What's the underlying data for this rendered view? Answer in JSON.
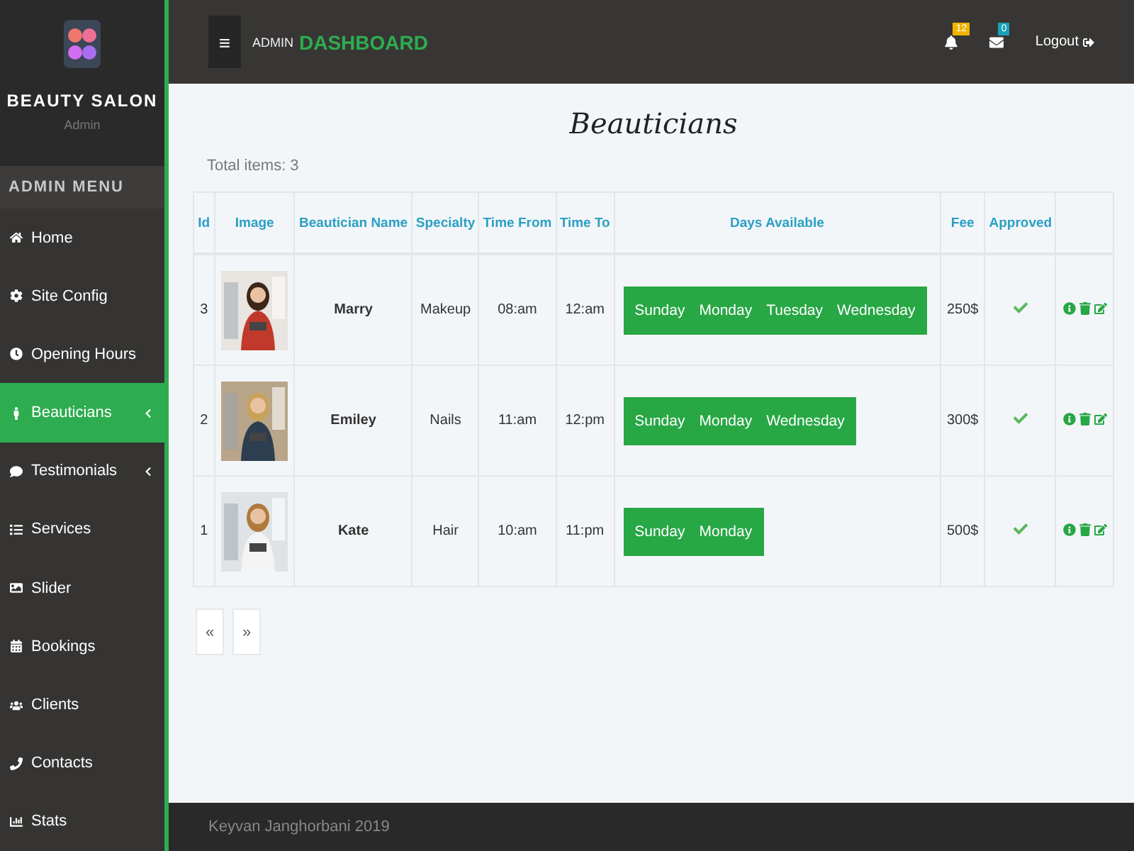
{
  "brand": {
    "title": "BEAUTY SALON",
    "subtitle": "Admin"
  },
  "menu_heading": "ADMIN MENU",
  "menu": [
    {
      "label": "Home",
      "selected": false,
      "submenu": false
    },
    {
      "label": "Site Config",
      "selected": false,
      "submenu": false
    },
    {
      "label": "Opening Hours",
      "selected": false,
      "submenu": false
    },
    {
      "label": "Beauticians",
      "selected": true,
      "submenu": true
    },
    {
      "label": "Testimonials",
      "selected": false,
      "submenu": true
    },
    {
      "label": "Services",
      "selected": false,
      "submenu": false
    },
    {
      "label": "Slider",
      "selected": false,
      "submenu": false
    },
    {
      "label": "Bookings",
      "selected": false,
      "submenu": false
    },
    {
      "label": "Clients",
      "selected": false,
      "submenu": false
    },
    {
      "label": "Contacts",
      "selected": false,
      "submenu": false
    },
    {
      "label": "Stats",
      "selected": false,
      "submenu": false
    }
  ],
  "topbar": {
    "menu_toggle": "≡",
    "title_prefix": "ADMIN",
    "title_main": "DASHBOARD",
    "notifications": "12",
    "messages": "0",
    "logout": "Logout"
  },
  "page_title": "Beauticians",
  "total": "Total items: 3",
  "table": {
    "columns": [
      "Id",
      "Image",
      "Beautician Name",
      "Specialty",
      "Time From",
      "Time To",
      "Days Available",
      "Fee",
      "Approved"
    ],
    "rows": [
      {
        "id": "3",
        "image": {
          "kind": "picture"
        },
        "name": "Marry",
        "specialty": "Makeup",
        "time_from": "08:am",
        "time_to": "12:am",
        "days": [
          "Sunday",
          "Monday",
          "Tuesday",
          "Wednesday"
        ],
        "fee": "250$",
        "approved": true
      },
      {
        "id": "2",
        "image": {
          "kind": "picture"
        },
        "name": "Emiley",
        "specialty": "Nails",
        "time_from": "11:am",
        "time_to": "12:pm",
        "days": [
          "Sunday",
          "Monday",
          "Wednesday"
        ],
        "fee": "300$",
        "approved": true
      },
      {
        "id": "1",
        "image": {
          "kind": "picture"
        },
        "name": "Kate",
        "specialty": "Hair",
        "time_from": "10:am",
        "time_to": "11:pm",
        "days": [
          "Sunday",
          "Monday"
        ],
        "fee": "500$",
        "approved": true
      }
    ]
  },
  "pagination": [
    "«",
    "»"
  ],
  "footer": "Keyvan Janghorbani 2019"
}
